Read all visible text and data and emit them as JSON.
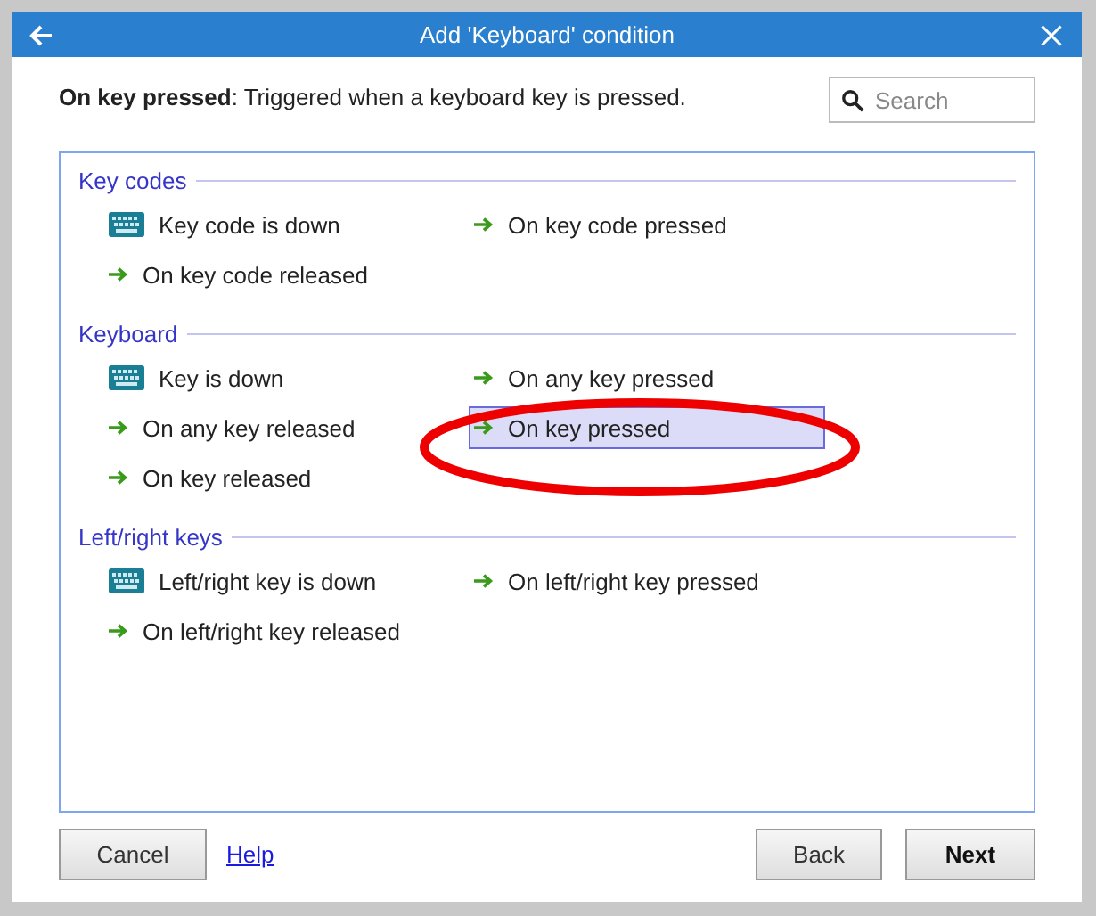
{
  "window": {
    "title": "Add 'Keyboard' condition"
  },
  "description": "**On key pressed**: Triggered when a keyboard key is pressed.",
  "search": {
    "placeholder": "Search"
  },
  "groups": [
    {
      "heading": "Key codes",
      "items": [
        {
          "label": "Key code is down",
          "kind": "condition",
          "selected": false
        },
        {
          "label": "On key code pressed",
          "kind": "trigger",
          "selected": false
        },
        {
          "label": "On key code released",
          "kind": "trigger",
          "selected": false
        }
      ]
    },
    {
      "heading": "Keyboard",
      "items": [
        {
          "label": "Key is down",
          "kind": "condition",
          "selected": false
        },
        {
          "label": "On any key pressed",
          "kind": "trigger",
          "selected": false
        },
        {
          "label": "On any key released",
          "kind": "trigger",
          "selected": false
        },
        {
          "label": "On key pressed",
          "kind": "trigger",
          "selected": true
        },
        {
          "label": "On key released",
          "kind": "trigger",
          "selected": false
        }
      ]
    },
    {
      "heading": "Left/right keys",
      "items": [
        {
          "label": "Left/right key is down",
          "kind": "condition",
          "selected": false
        },
        {
          "label": "On left/right key pressed",
          "kind": "trigger",
          "selected": false
        },
        {
          "label": "On left/right key released",
          "kind": "trigger",
          "selected": false
        }
      ]
    }
  ],
  "highlight_ellipse": true,
  "buttons": {
    "cancel": "Cancel",
    "help": "Help",
    "back": "Back",
    "next": "Next"
  }
}
